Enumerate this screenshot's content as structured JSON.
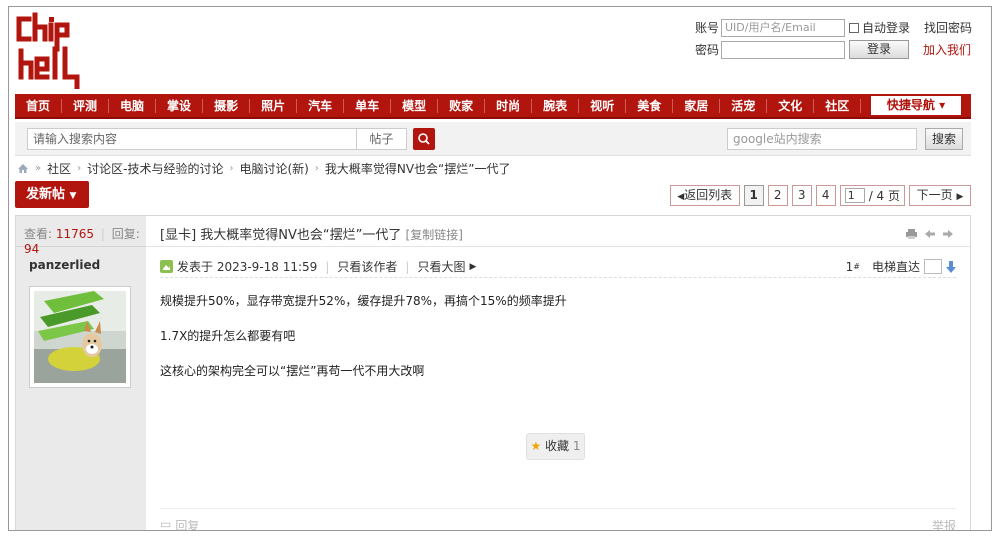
{
  "logo": {
    "text": "chip hell"
  },
  "login": {
    "account_label": "账号",
    "account_placeholder": "UID/用户名/Email",
    "auto_login": "自动登录",
    "find_password": "找回密码",
    "password_label": "密码",
    "login_button": "登录",
    "join_us": "加入我们"
  },
  "nav": {
    "items": [
      "首页",
      "评测",
      "电脑",
      "掌设",
      "摄影",
      "照片",
      "汽车",
      "单车",
      "模型",
      "败家",
      "时尚",
      "腕表",
      "视听",
      "美食",
      "家居",
      "活宠",
      "文化",
      "社区"
    ],
    "quick_nav": "快捷导航"
  },
  "search": {
    "placeholder": "请输入搜索内容",
    "type": "帖子",
    "google_placeholder": "google站内搜索",
    "google_button": "搜索"
  },
  "breadcrumb": [
    "社区",
    "讨论区-技术与经验的讨论",
    "电脑讨论(新)",
    "我大概率觉得NV也会“摆烂”一代了"
  ],
  "post_button": "发新帖",
  "pager": {
    "back": "返回列表",
    "pages": [
      "1",
      "2",
      "3",
      "4"
    ],
    "current_input": "1",
    "total": "/ 4 页",
    "next": "下一页"
  },
  "stats": {
    "views_label": "查看:",
    "views": "11765",
    "replies_label": "回复:",
    "replies": "94"
  },
  "thread": {
    "title": "[显卡] 我大概率觉得NV也会“摆烂”一代了",
    "copy_link": "[复制链接]"
  },
  "post": {
    "author": "panzerlied",
    "posted_at": "发表于 2023-9-18 11:59",
    "only_author": "只看该作者",
    "big_image": "只看大图",
    "floor": "1",
    "floor_suffix": "#",
    "elevator": "电梯直达",
    "lines": [
      "规模提升50%，显存带宽提升52%，缓存提升78%，再搞个15%的频率提升",
      "1.7X的提升怎么都要有吧",
      "这核心的架构完全可以“摆烂”再苟一代不用大改啊"
    ],
    "favorite_label": "收藏",
    "favorite_count": "1",
    "reply": "回复",
    "report": "举报"
  },
  "colors": {
    "brand_red": "#b1150e",
    "sidebar_bg": "#eaeaea"
  }
}
